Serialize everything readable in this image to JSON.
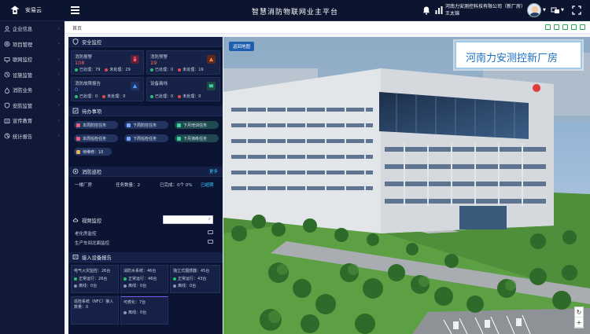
{
  "app": {
    "logo_text": "安易云",
    "title": "智慧消防物联网业主平台"
  },
  "header": {
    "company": "河南力安测控科技有限公司（新厂房）",
    "user": "王太锦"
  },
  "sidebar": {
    "items": [
      {
        "label": "企业信息",
        "icon": "building-icon"
      },
      {
        "label": "项目管理",
        "icon": "project-icon"
      },
      {
        "label": "联网监控",
        "icon": "monitor-icon"
      },
      {
        "label": "设施监管",
        "icon": "facility-icon"
      },
      {
        "label": "消防业务",
        "icon": "fire-icon"
      },
      {
        "label": "安防监管",
        "icon": "shield-icon"
      },
      {
        "label": "宣传教育",
        "icon": "education-icon"
      },
      {
        "label": "统计报告",
        "icon": "report-icon"
      }
    ]
  },
  "breadcrumb": "首页",
  "safety": {
    "title": "安全监控",
    "cards": [
      {
        "title": "消防报警",
        "value": "108",
        "processed_label": "已处理：",
        "processed": "79",
        "unprocessed_label": "未处理：",
        "unprocessed": "29",
        "value_color": "#ff5b6e"
      },
      {
        "title": "消防预警",
        "value": "19",
        "processed_label": "已处理：",
        "processed": "0",
        "unprocessed_label": "未处理：",
        "unprocessed": "19",
        "value_color": "#ff7a45"
      },
      {
        "title": "消防故障报告",
        "value": "0",
        "processed_label": "已处理：",
        "processed": "0",
        "unprocessed_label": "未处理：",
        "unprocessed": "0",
        "value_color": "#4f9cff"
      },
      {
        "title": "设备离线",
        "value": "",
        "processed_label": "已处理：",
        "processed": "0",
        "unprocessed_label": "未处理：",
        "unprocessed": "0",
        "value_color": "#3bd2a0"
      }
    ]
  },
  "todo": {
    "title": "待办事项",
    "items": [
      "本周防控任务",
      "下周防控任务",
      "下月培训任务",
      "本周巡检任务",
      "下周巡检任务",
      "下月演练任务",
      "待维修：10"
    ]
  },
  "inspection": {
    "title": "消防巡检",
    "more": "更多",
    "area": "一楼厂房",
    "task_label": "任务数量：",
    "task_count": "2",
    "done_label": "已完成：",
    "done": "0个 0%",
    "status": "已超期"
  },
  "video": {
    "title": "视频监控",
    "search_placeholder": "",
    "cameras": [
      "老化房监控",
      "生产车间北面监控"
    ]
  },
  "devices": {
    "title": "接入设备报告",
    "items": [
      {
        "name": "电气火灾监控：26台",
        "normal": "正常运行：",
        "normal_v": "26台",
        "offline": "离线：",
        "offline_v": "0台"
      },
      {
        "name": "消防水系统：46台",
        "normal": "正常运行：",
        "normal_v": "46台",
        "offline": "离线：",
        "offline_v": "0台"
      },
      {
        "name": "独立式烟感器：45台",
        "normal": "正常运行：",
        "normal_v": "43台",
        "offline": "离线：",
        "offline_v": "0台"
      },
      {
        "name": "巡检系统（NFC）接入数量：0",
        "normal": "",
        "normal_v": "",
        "offline": "",
        "offline_v": ""
      },
      {
        "name": "可燃化：7台",
        "normal": "",
        "normal_v": "",
        "offline": "离线：",
        "offline_v": "0台"
      }
    ]
  },
  "map": {
    "button": "返回地图",
    "location_label": "河南力安测控新厂房",
    "zoom_in": "+",
    "reset": "↻"
  }
}
